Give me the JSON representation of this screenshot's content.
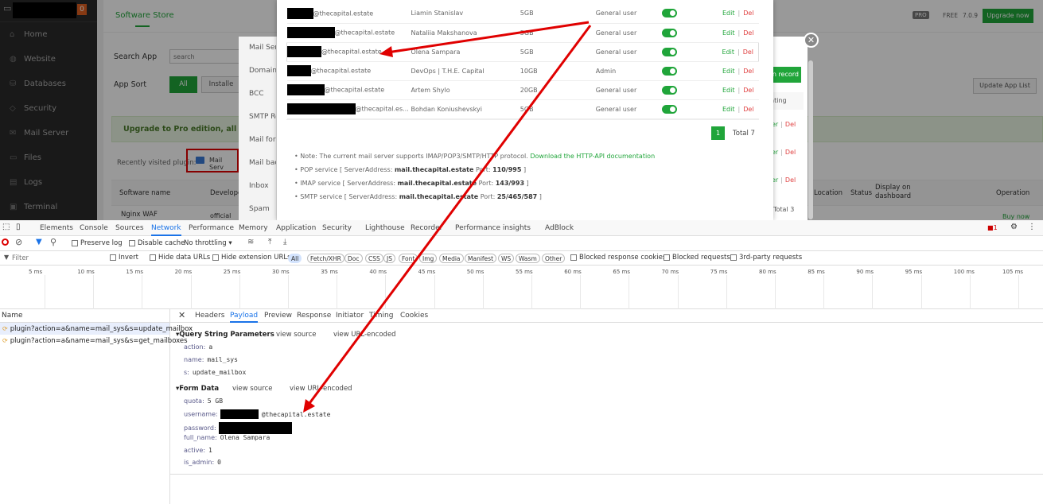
{
  "sidebar": {
    "badge": "0",
    "items": [
      {
        "icon": "home-icon",
        "label": "Home"
      },
      {
        "icon": "globe-icon",
        "label": "Website"
      },
      {
        "icon": "database-icon",
        "label": "Databases"
      },
      {
        "icon": "shield-icon",
        "label": "Security"
      },
      {
        "icon": "mail-icon",
        "label": "Mail Server"
      },
      {
        "icon": "folder-icon",
        "label": "Files"
      },
      {
        "icon": "logs-icon",
        "label": "Logs"
      },
      {
        "icon": "terminal-icon",
        "label": "Terminal"
      }
    ]
  },
  "main": {
    "tab": "Software Store",
    "search_label": "Search App",
    "search_placeholder": "search",
    "sort_label": "App Sort",
    "sort_all": "All",
    "sort_installed": "Installe",
    "pro_badge": "PRO",
    "free_label": "FREE",
    "version": "7.0.9",
    "upgrade_now": "Upgrade now",
    "update_list": "Update App List",
    "upgrade_banner": "Upgrade to Pro edition, all plugins",
    "recent_label": "Recently visited plugin:",
    "recent_plugin": "Mail Serv",
    "software_name_col": "Software name",
    "developer_col": "Develope",
    "location_col": "Location",
    "status_col": "Status",
    "display_col": "Display on dashboard",
    "operation_col": "Operation",
    "row1_name": "Nginx WAF",
    "row1_dev": "official",
    "row1_op": "Buy now"
  },
  "modal1": {
    "menu": [
      "Mail Ser",
      "Domain L",
      "BCC",
      "SMTP Rel",
      "Mail forw",
      "Mail back",
      "Inbox",
      "Spam"
    ],
    "add_record": "n record",
    "operating": "erating",
    "del_rows": [
      "er",
      "er",
      "er"
    ],
    "del_label": "Del",
    "total": "Total 3"
  },
  "modal2": {
    "rows": [
      {
        "suffix": "@thecapital.estate",
        "name": "Liamin Stanislav",
        "quota": "5GB",
        "role": "General user"
      },
      {
        "suffix": "@thecapital.estate",
        "name": "Nataliia Makshanova",
        "quota": "5GB",
        "role": "General user"
      },
      {
        "suffix": "@thecapital.estate",
        "name": "Olena Sampara",
        "quota": "5GB",
        "role": "General user"
      },
      {
        "suffix": "@thecapital.estate",
        "name": "DevOps | T.H.E. Capital",
        "quota": "10GB",
        "role": "Admin"
      },
      {
        "suffix": "@thecapital.estate",
        "name": "Artem Shylo",
        "quota": "20GB",
        "role": "General user"
      },
      {
        "suffix": "@thecapital.es...",
        "name": "Bohdan Koniushevskyi",
        "quota": "5GB",
        "role": "General user"
      }
    ],
    "edit": "Edit",
    "sep": "|",
    "del": "Del",
    "page": "1",
    "total": "Total 7",
    "note": "Note: The current mail server supports IMAP/POP3/SMTP/HTTP protocol.",
    "note_link": "Download the HTTP-API documentation",
    "pop_a": "POP service [ ServerAddress: ",
    "pop_b": "mail.thecapital.estate",
    "pop_c": " Port: ",
    "pop_d": "110/995",
    "pop_e": " ]",
    "imap_a": "IMAP service [ ServerAddress: ",
    "imap_b": "mail.thecapital.estate",
    "imap_c": " Port: ",
    "imap_d": "143/993",
    "imap_e": " ]",
    "smtp_a": "SMTP service [ ServerAddress: ",
    "smtp_b": "mail.thecapital.estate",
    "smtp_c": " Port: ",
    "smtp_d": "25/465/587",
    "smtp_e": " ]"
  },
  "devtools": {
    "tabs": [
      "Elements",
      "Console",
      "Sources",
      "Network",
      "Performance",
      "Memory",
      "Application",
      "Security",
      "Lighthouse",
      "Recorder",
      "Performance insights",
      "AdBlock"
    ],
    "active_tab": "Network",
    "err_count": "1",
    "preserve_log": "Preserve log",
    "disable_cache": "Disable cache",
    "throttling": "No throttling",
    "filter_placeholder": "Filter",
    "invert": "Invert",
    "hide_data": "Hide data URLs",
    "hide_ext": "Hide extension URLs",
    "types": [
      "All",
      "Fetch/XHR",
      "Doc",
      "CSS",
      "JS",
      "Font",
      "Img",
      "Media",
      "Manifest",
      "WS",
      "Wasm",
      "Other"
    ],
    "blocked_cookies": "Blocked response cookies",
    "blocked_requests": "Blocked requests",
    "third_party": "3rd-party requests",
    "ticks": [
      "5 ms",
      "10 ms",
      "15 ms",
      "20 ms",
      "25 ms",
      "30 ms",
      "35 ms",
      "40 ms",
      "45 ms",
      "50 ms",
      "55 ms",
      "60 ms",
      "65 ms",
      "70 ms",
      "75 ms",
      "80 ms",
      "85 ms",
      "90 ms",
      "95 ms",
      "100 ms",
      "105 ms"
    ],
    "name_header": "Name",
    "requests": [
      "plugin?action=a&name=mail_sys&s=update_mailbox",
      "plugin?action=a&name=mail_sys&s=get_mailboxes"
    ],
    "detail_tabs": [
      "Headers",
      "Payload",
      "Preview",
      "Response",
      "Initiator",
      "Timing",
      "Cookies"
    ],
    "active_detail": "Payload",
    "qs_title": "▾Query String Parameters",
    "view_source": "view source",
    "view_url": "view URL-encoded",
    "qs": [
      {
        "k": "action:",
        "v": "a"
      },
      {
        "k": "name:",
        "v": "mail_sys"
      },
      {
        "k": "s:",
        "v": "update_mailbox"
      }
    ],
    "fd_title": "▾Form Data",
    "fd": [
      {
        "k": "quota:",
        "v": "5 GB"
      },
      {
        "k": "username:",
        "v": "@thecapital.estate"
      },
      {
        "k": "password:",
        "v": ""
      },
      {
        "k": "full_name:",
        "v": "Olena Sampara"
      },
      {
        "k": "active:",
        "v": "1"
      },
      {
        "k": "is_admin:",
        "v": "0"
      }
    ]
  },
  "colors": {
    "accent": "#20a53a",
    "arrow": "#e00000",
    "danger": "#e04040"
  }
}
